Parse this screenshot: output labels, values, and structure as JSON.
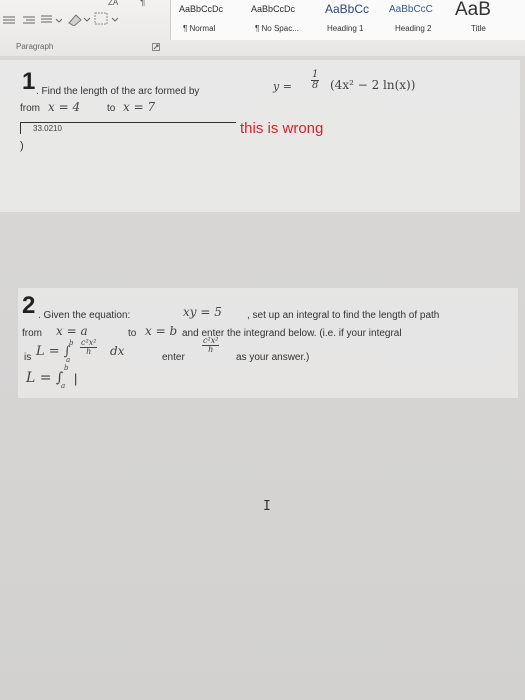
{
  "ribbon": {
    "sort_icon_label": "ZA",
    "pilcrow": "¶",
    "group_label": "Paragraph",
    "styles": [
      {
        "preview": "AaBbCcDc",
        "name": "¶ Normal"
      },
      {
        "preview": "AaBbCcDc",
        "name": "¶ No Spac..."
      },
      {
        "preview": "AaBbCc",
        "name": "Heading 1"
      },
      {
        "preview": "AaBbCcC",
        "name": "Heading 2"
      },
      {
        "preview": "AaB",
        "name": "Title"
      }
    ]
  },
  "question1": {
    "number": "1",
    "text": ". Find the length of the arc formed by",
    "equation_lhs": "y =",
    "fraction_num": "1",
    "fraction_den": "8",
    "equation_rhs": "(4x² − 2 ln(x))",
    "from_word": "from",
    "from_eq": "x = 4",
    "to_word": "to",
    "to_eq": "x = 7",
    "answer_value": "33.0210",
    "feedback": "this is wrong",
    "closing_paren": ")"
  },
  "question2": {
    "number": "2",
    "text_a": ". Given the equation:",
    "equation": "xy = 5",
    "text_b": ", set up an integral to find the length of path",
    "from_word": "from",
    "from_eq": "x = a",
    "to_word": "to",
    "to_eq": "x = b",
    "text_c": "and enter the integrand below. (i.e. if your integral",
    "is_word": "is",
    "integral_example": "L = ∫",
    "integral_upper": "b",
    "integral_lower": "a",
    "example_num": "c²x²",
    "example_den": "h",
    "dx": "dx",
    "enter_word": "enter",
    "as_answer": "as your answer.)",
    "answer_lhs": "L = ∫",
    "answer_upper": "b",
    "answer_lower": "a",
    "answer_cursor": "|"
  },
  "cursor": {
    "glyph": "I"
  }
}
